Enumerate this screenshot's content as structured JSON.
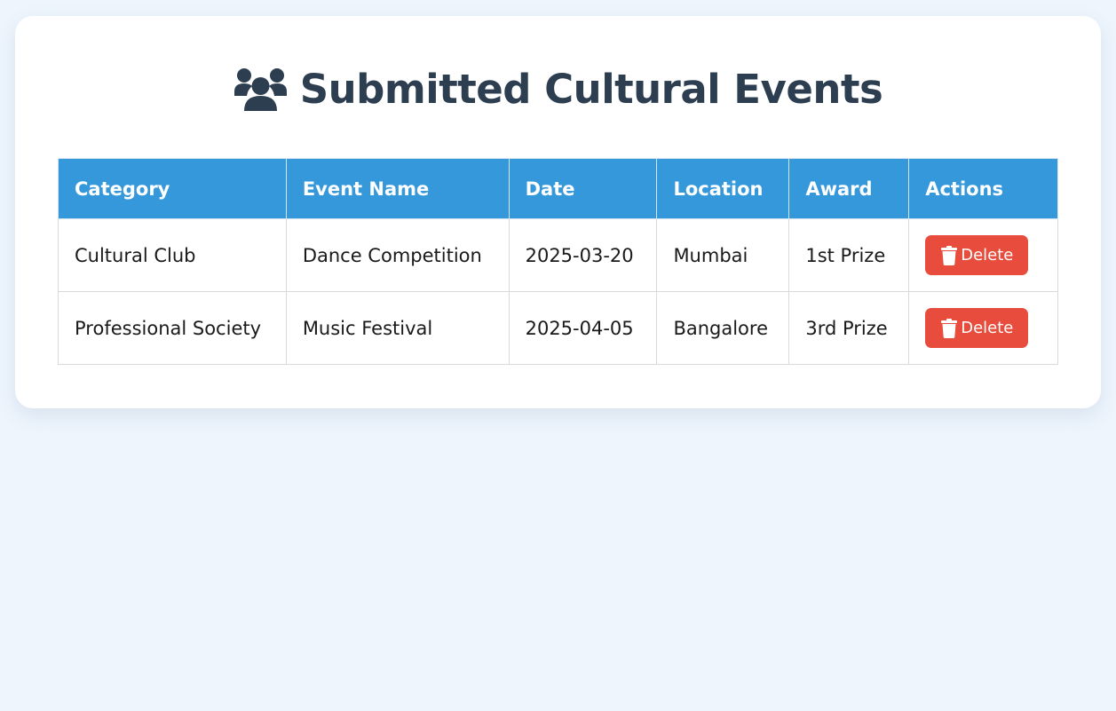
{
  "page": {
    "title": "Submitted Cultural Events",
    "title_icon": "users-icon"
  },
  "table": {
    "headers": [
      "Category",
      "Event Name",
      "Date",
      "Location",
      "Award",
      "Actions"
    ],
    "rows": [
      {
        "category": "Cultural Club",
        "event_name": "Dance Competition",
        "date": "2025-03-20",
        "location": "Mumbai",
        "award": "1st Prize",
        "action_label": "Delete",
        "action_icon": "trash-icon"
      },
      {
        "category": "Professional Society",
        "event_name": "Music Festival",
        "date": "2025-04-05",
        "location": "Bangalore",
        "award": "3rd Prize",
        "action_label": "Delete",
        "action_icon": "trash-icon"
      }
    ]
  },
  "colors": {
    "background": "#eef5fd",
    "card": "#ffffff",
    "title": "#2c3e50",
    "header": "#3498db",
    "delete": "#e74c3c"
  }
}
